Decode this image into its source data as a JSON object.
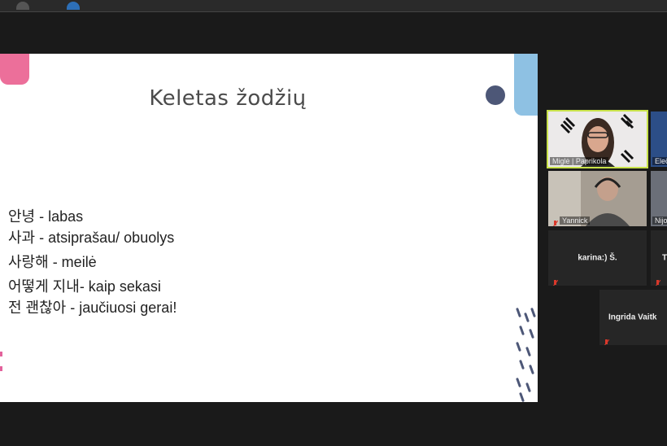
{
  "slide": {
    "title": "Keletas žodžių",
    "words": [
      {
        "kr": "안녕",
        "lt": " - labas"
      },
      {
        "kr": "사과",
        "lt": " - atsiprašau/ obuolys"
      },
      {
        "kr": "사랑해",
        "lt": " - meilė"
      },
      {
        "kr": "어떻게 지내",
        "lt": "- kaip sekasi"
      },
      {
        "kr": "전 괜찮아",
        "lt": " - jaučiuosi gerai!"
      }
    ]
  },
  "participants": [
    {
      "name": "Miglė | Paprikola",
      "active": true
    },
    {
      "name": "Elečk"
    },
    {
      "name": "Yannick"
    },
    {
      "name": "Nijolė"
    },
    {
      "name": "karina:) Š."
    },
    {
      "name": "T"
    },
    {
      "name": "Ingrida  Vaitk"
    }
  ],
  "colors": {
    "active_speaker": "#c8e24a",
    "muted": "#d9382b"
  }
}
